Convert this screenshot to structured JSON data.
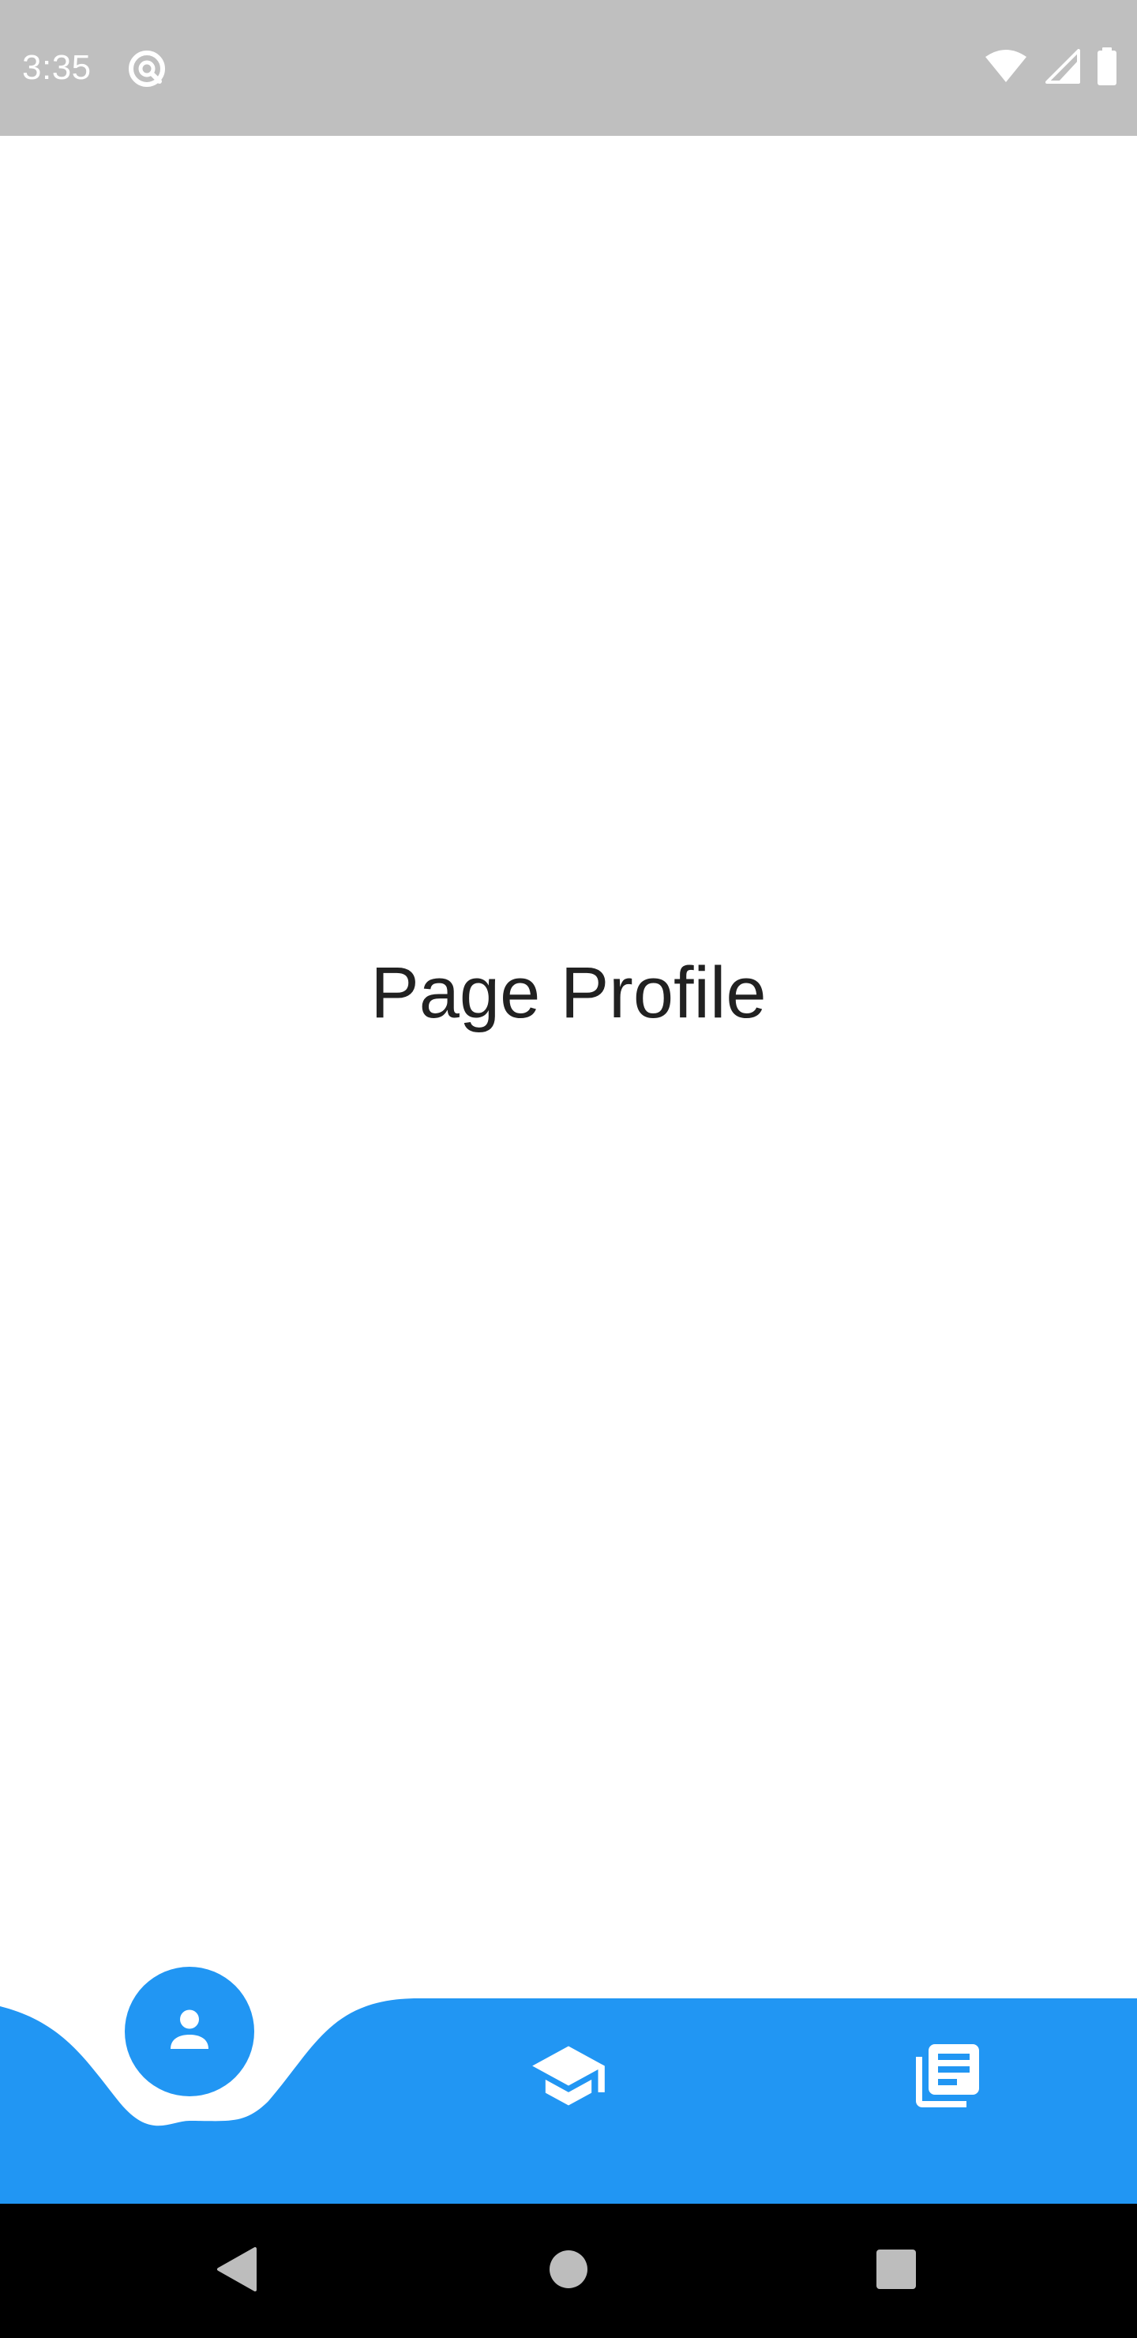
{
  "status_bar": {
    "time": "3:35",
    "icons": [
      "app-notification-icon",
      "wifi-icon",
      "cellular-signal-icon",
      "battery-icon"
    ]
  },
  "main": {
    "page_title": "Page Profile"
  },
  "bottom_nav": {
    "active_color": "#2196F3",
    "items": [
      {
        "icon": "person-icon",
        "active": true
      },
      {
        "icon": "school-icon",
        "active": false
      },
      {
        "icon": "news-icon",
        "active": false
      }
    ]
  },
  "system_nav": {
    "buttons": [
      "back-icon",
      "home-icon",
      "recents-icon"
    ]
  },
  "colors": {
    "status_bar_bg": "#bfbfbf",
    "accent": "#2196F3",
    "text": "#212121",
    "system_nav_bg": "#000000"
  }
}
